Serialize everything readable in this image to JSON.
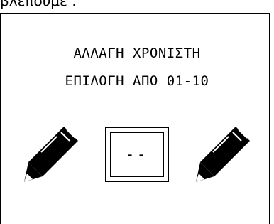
{
  "header": {
    "partial_text": "βλέπουμε :"
  },
  "screen": {
    "line1": "ΑΛΛΑΓΗ ΧΡΟΝΙΣΤΗ",
    "line2": "ΕΠΙΛΟΓΗ ΑΠΟ 01-10",
    "value": "--"
  },
  "icons": {
    "left": "pencil-icon",
    "right": "pencil-icon"
  }
}
